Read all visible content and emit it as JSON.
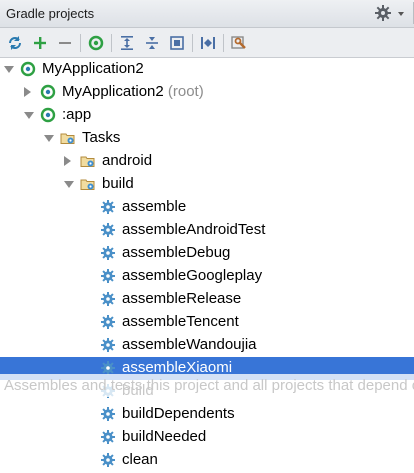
{
  "panel": {
    "title": "Gradle projects",
    "settings_icon": "gear-icon",
    "toolbar": [
      {
        "icon": "refresh-icon",
        "color": "#2a7ab0"
      },
      {
        "icon": "add-icon",
        "color": "#2ea043"
      },
      {
        "icon": "remove-icon",
        "color": "#8a8a8a"
      },
      {
        "icon": "execute-task-icon",
        "color": "#2ea043"
      },
      {
        "icon": "expand-all-icon",
        "color": "#4a6fa5"
      },
      {
        "icon": "collapse-all-icon",
        "color": "#4a6fa5"
      },
      {
        "icon": "group-icon",
        "color": "#4a6fa5"
      },
      {
        "icon": "toggle-offline-icon",
        "color": "#4a6fa5"
      },
      {
        "icon": "gradle-settings-icon",
        "color": "#b46a2e"
      }
    ]
  },
  "tree": [
    {
      "label": "MyApplication2",
      "suffix": "",
      "icon": "gradle-project-icon",
      "arrow": "down"
    },
    {
      "label": "MyApplication2",
      "suffix": " (root)",
      "icon": "gradle-project-icon",
      "arrow": "right"
    },
    {
      "label": ":app",
      "suffix": "",
      "icon": "gradle-project-icon",
      "arrow": "down"
    },
    {
      "label": "Tasks",
      "suffix": "",
      "icon": "task-folder-icon",
      "arrow": "down"
    },
    {
      "label": "android",
      "suffix": "",
      "icon": "task-folder-icon",
      "arrow": "right"
    },
    {
      "label": "build",
      "suffix": "",
      "icon": "task-folder-icon",
      "arrow": "down"
    },
    {
      "label": "assemble",
      "suffix": "",
      "icon": "task-gear-icon",
      "arrow": ""
    },
    {
      "label": "assembleAndroidTest",
      "suffix": "",
      "icon": "task-gear-icon",
      "arrow": ""
    },
    {
      "label": "assembleDebug",
      "suffix": "",
      "icon": "task-gear-icon",
      "arrow": ""
    },
    {
      "label": "assembleGoogleplay",
      "suffix": "",
      "icon": "task-gear-icon",
      "arrow": ""
    },
    {
      "label": "assembleRelease",
      "suffix": "",
      "icon": "task-gear-icon",
      "arrow": ""
    },
    {
      "label": "assembleTencent",
      "suffix": "",
      "icon": "task-gear-icon",
      "arrow": ""
    },
    {
      "label": "assembleWandoujia",
      "suffix": "",
      "icon": "task-gear-icon",
      "arrow": ""
    },
    {
      "label": "assembleXiaomi",
      "suffix": "",
      "icon": "task-gear-icon",
      "arrow": "",
      "selected": true
    },
    {
      "label": "build",
      "suffix": "",
      "icon": "task-gear-icon",
      "arrow": ""
    },
    {
      "label": "buildDependents",
      "suffix": "",
      "icon": "task-gear-icon",
      "arrow": ""
    },
    {
      "label": "buildNeeded",
      "suffix": "",
      "icon": "task-gear-icon",
      "arrow": ""
    },
    {
      "label": "clean",
      "suffix": "",
      "icon": "task-gear-icon",
      "arrow": ""
    }
  ],
  "tooltip": "Assembles and tests this project and all projects that depend on it.",
  "colors": {
    "selection": "#3875d7",
    "gradle_green": "#2ea043",
    "folder": "#c9a25a",
    "task_gear": "#4a90c8"
  }
}
